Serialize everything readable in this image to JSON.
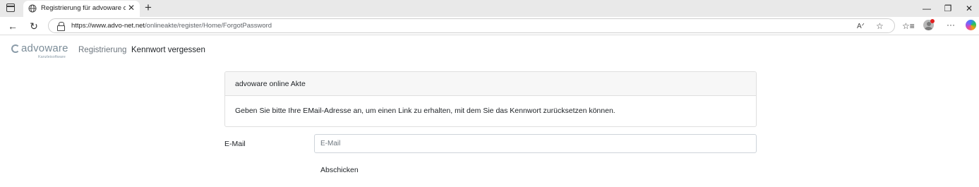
{
  "browser": {
    "tab_title": "Registrierung für advoware online",
    "url_host": "https://www.advo-net.net",
    "url_path": "/onlineakte/register/Home/ForgotPassword",
    "icons": [
      "window-menu-icon",
      "globe-icon",
      "close-icon",
      "plus-icon",
      "minimize-icon",
      "restore-icon",
      "back-icon",
      "reload-icon",
      "lock-icon",
      "read-aloud-icon",
      "star-icon",
      "favorites-icon",
      "profile-icon",
      "more-icon",
      "copilot-icon"
    ]
  },
  "header": {
    "logo_text": "advoware",
    "logo_subtitle": "Kanzleisoftware",
    "nav": {
      "register": "Registrierung",
      "forgot_password": "Kennwort vergessen"
    }
  },
  "card": {
    "title": "advoware online Akte",
    "body": "Geben Sie bitte Ihre EMail-Adresse an, um einen Link zu erhalten, mit dem Sie das Kennwort zurücksetzen können."
  },
  "form": {
    "email_label": "E-Mail",
    "email_placeholder": "E-Mail",
    "email_value": "",
    "submit_label": "Abschicken"
  },
  "colors": {
    "logo": "#7b8c98",
    "card_header_bg": "#f7f7f7",
    "text": "#212529",
    "muted": "#6c757d"
  }
}
